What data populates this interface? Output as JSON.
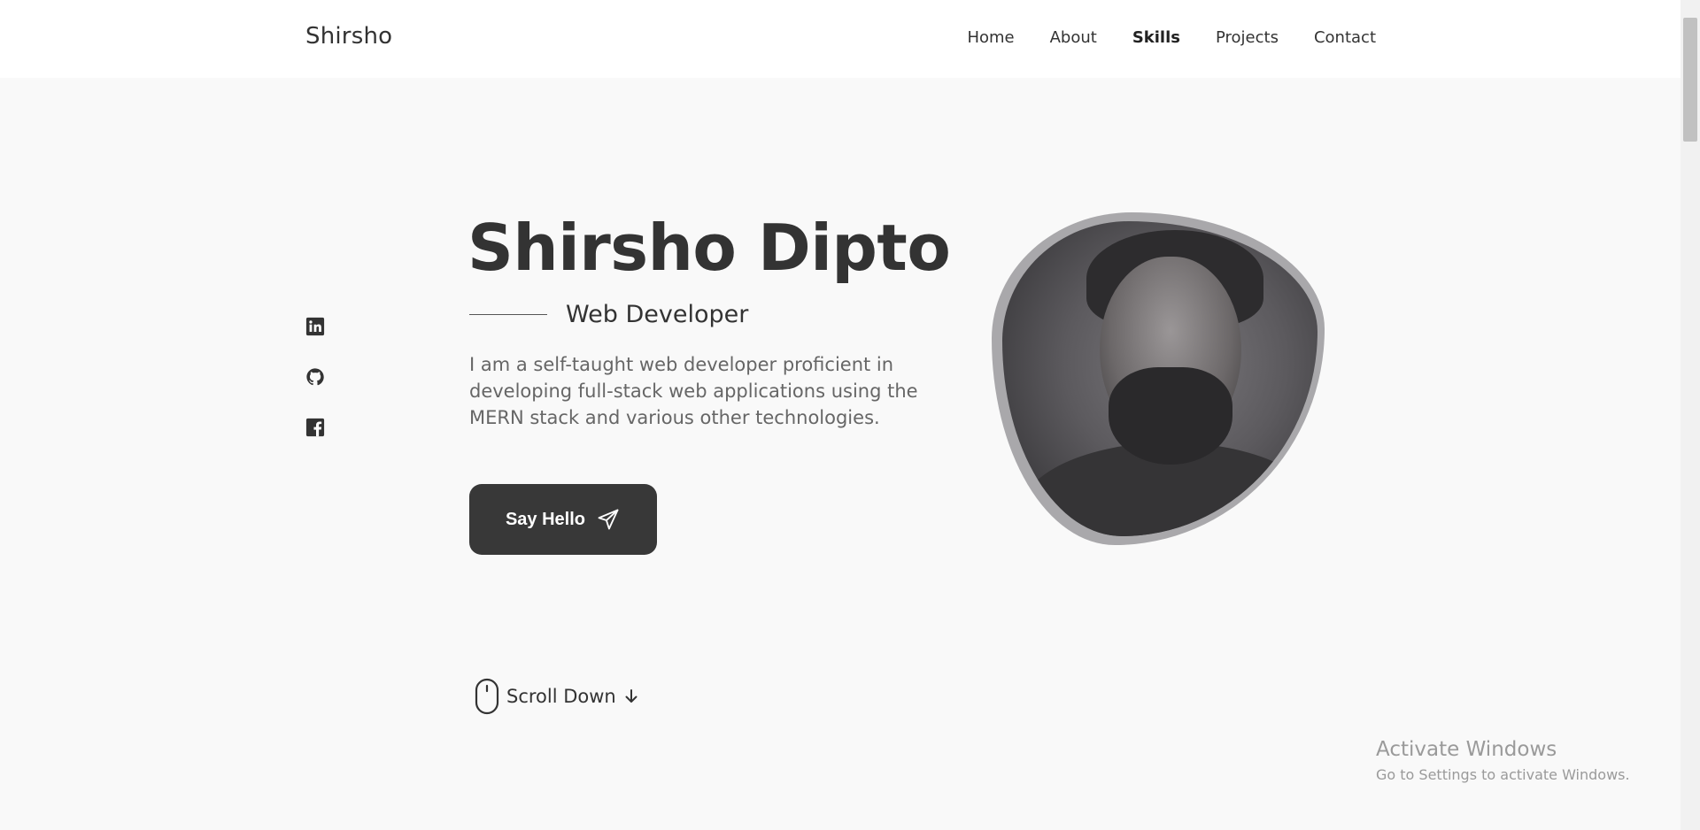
{
  "header": {
    "logo": "Shirsho",
    "nav": [
      {
        "label": "Home",
        "active": false
      },
      {
        "label": "About",
        "active": false
      },
      {
        "label": "Skills",
        "active": true
      },
      {
        "label": "Projects",
        "active": false
      },
      {
        "label": "Contact",
        "active": false
      }
    ]
  },
  "social": [
    {
      "icon": "linkedin-icon"
    },
    {
      "icon": "github-icon"
    },
    {
      "icon": "facebook-icon"
    }
  ],
  "hero": {
    "title": "Shirsho Dipto",
    "subtitle": "Web Developer",
    "description": "I am a self-taught web developer proficient in developing full-stack web applications using the MERN stack and various other technologies.",
    "button_label": "Say Hello",
    "button_icon": "send-icon"
  },
  "scroll": {
    "label": "Scroll Down",
    "mouse_icon": "mouse-icon",
    "arrow_icon": "arrow-down-icon"
  },
  "watermark": {
    "title": "Activate Windows",
    "subtitle": "Go to Settings to activate Windows."
  },
  "colors": {
    "background": "#f9f9f9",
    "header": "#ffffff",
    "text": "#333333",
    "button": "#383838",
    "blob": "#a9a8ab"
  }
}
